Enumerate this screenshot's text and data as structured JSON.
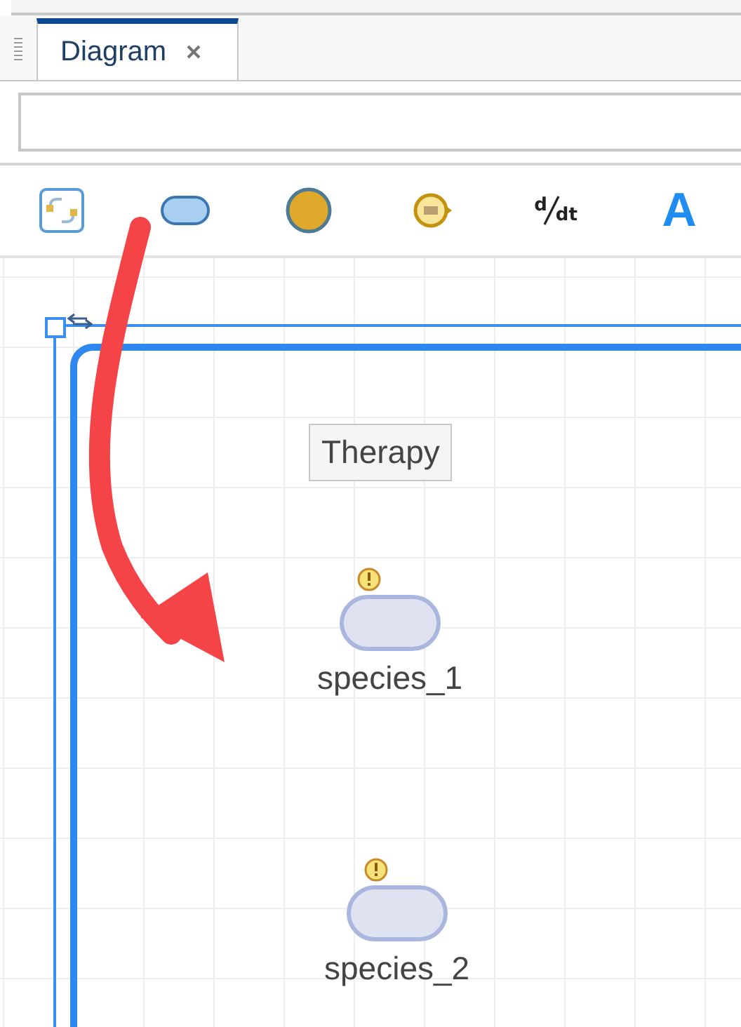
{
  "tabs": [
    {
      "label": "Diagram",
      "selected": true,
      "closable": true
    }
  ],
  "toolbar": [
    {
      "kind": "compartment"
    },
    {
      "kind": "species"
    },
    {
      "kind": "parameter"
    },
    {
      "kind": "reaction"
    },
    {
      "kind": "rate",
      "numerator": "d",
      "denominator": "dt"
    },
    {
      "kind": "text",
      "label": "A"
    }
  ],
  "canvas": {
    "compartment": {
      "label": "Therapy",
      "selected": true
    },
    "species": [
      {
        "name": "species_1",
        "warning": true
      },
      {
        "name": "species_2",
        "warning": true
      }
    ]
  }
}
